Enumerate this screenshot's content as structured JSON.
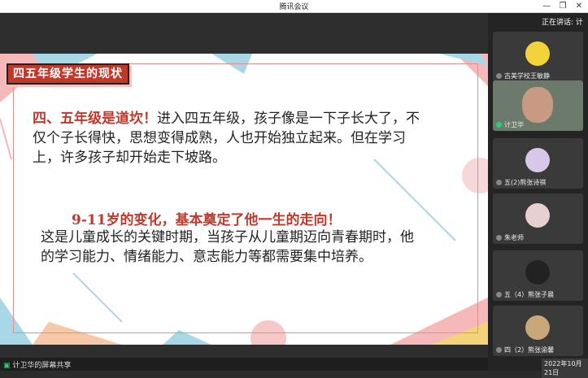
{
  "window": {
    "title": "腾讯会议"
  },
  "slide": {
    "title": "四五年级学生的现状",
    "para1_highlight": "四、五年级是道坎！",
    "para1_text": "进入四五年级，孩子像是一下子长大了，不仅个子长得快，思想变得成熟，人也开始独立起来。但在学习上，许多孩子却开始走下坡路。",
    "para2_head": "9-11岁的变化，基本奠定了他一生的走向！",
    "para2_text": "这是儿童成长的关键时期，当孩子从儿童期迈向青春期时，他的学习能力、情绪能力、意志能力等都需要集中培养。"
  },
  "sidebar": {
    "speaking_label": "正在讲话: 计",
    "participants": [
      {
        "name": "古美学校王敏静"
      },
      {
        "name": "计卫华"
      },
      {
        "name": "五(2)熊张诗祺"
      },
      {
        "name": "朱老师"
      },
      {
        "name": "五（4）熊张子晨"
      },
      {
        "name": "四（2）熊张渝馨"
      }
    ]
  },
  "bottom": {
    "share_label": "计卫华的屏幕共享",
    "date": "2022年10月21日"
  },
  "colors": {
    "accent_red": "#c0392b",
    "tile_bg": "#3a3a3a"
  }
}
